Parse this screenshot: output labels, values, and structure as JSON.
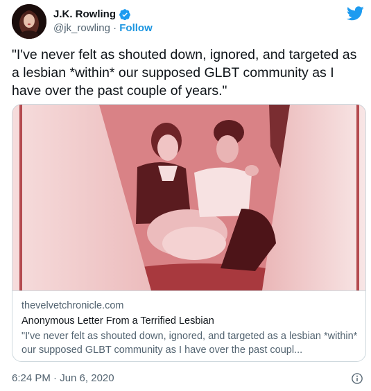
{
  "author": {
    "name": "J.K. Rowling",
    "handle": "@jk_rowling",
    "separator": " · ",
    "follow_label": "Follow",
    "avatar_icon": "profile-photo",
    "verified_icon": "verified-badge-icon"
  },
  "tweet": {
    "text": "\"I've never felt as shouted down, ignored, and targeted as a lesbian *within* our supposed GLBT community as I have over the past couple of years.\""
  },
  "card": {
    "image_icon": "two-women-sitting-photo",
    "domain": "thevelvetchronicle.com",
    "title": "Anonymous Letter From a Terrified Lesbian",
    "description": "\"I've never felt as shouted down, ignored, and targeted as a lesbian *within* our supposed GLBT community as I have over the past coupl..."
  },
  "footer": {
    "timestamp": "6:24 PM · Jun 6, 2020",
    "info_icon": "info-icon"
  },
  "colors": {
    "accent": "#1b95e0",
    "twitter_blue": "#1d9bf0",
    "secondary_text": "#536471",
    "image_tint": "#d8868a"
  }
}
